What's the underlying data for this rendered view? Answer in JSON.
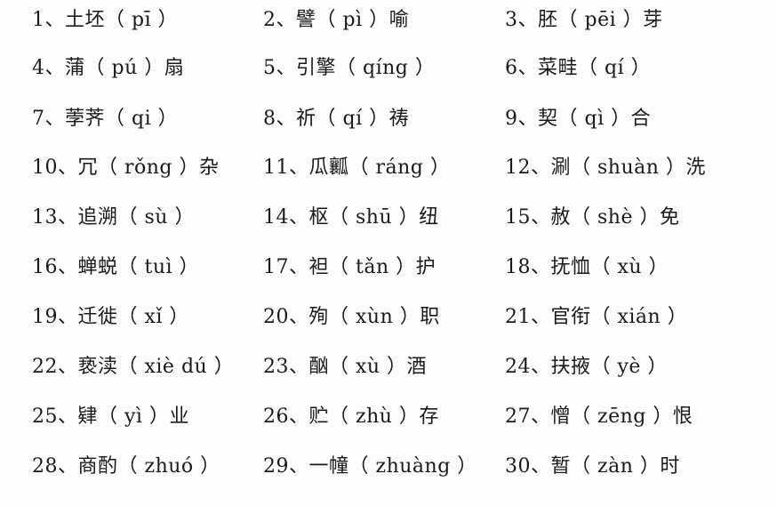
{
  "rows": [
    [
      {
        "text": "1、土坯（ pī ）"
      },
      {
        "text": "2、譬（ pì ）喻"
      },
      {
        "text": "3、胚（ pēi ）芽"
      }
    ],
    [
      {
        "text": "4、蒲（ pú ）扇"
      },
      {
        "text": "5、引擎（ qíng ）"
      },
      {
        "text": "6、菜畦（  qí  ）"
      }
    ],
    [
      {
        "text": "7、荸荠（  qi  ）"
      },
      {
        "text": "8、祈（  qí  ）祷"
      },
      {
        "text": "9、契（ qì ）合"
      }
    ],
    [
      {
        "text": "10、冗（ rǒng ）杂"
      },
      {
        "text": "11、瓜瓤（ ráng ）"
      },
      {
        "text": "12、涮（ shuàn ）洗"
      }
    ],
    [
      {
        "text": "13、追溯（  sù  ）"
      },
      {
        "text": "14、枢（  shū  ）纽"
      },
      {
        "text": "15、赦（ shè ）免"
      }
    ],
    [
      {
        "text": "16、蝉蜕（  tuì  ）"
      },
      {
        "text": "17、袒（ tǎn ）护"
      },
      {
        "text": "18、抚恤（  xù  ）"
      }
    ],
    [
      {
        "text": "19、迁徙（  xǐ  ）"
      },
      {
        "text": "20、殉（  xùn  ）职"
      },
      {
        "text": "21、官衔（  xián  ）"
      }
    ],
    [
      {
        "text": "22、亵渎（  xiè dú  ）"
      },
      {
        "text": "23、酗（  xù  ）酒"
      },
      {
        "text": "24、扶掖（  yè  ）"
      }
    ],
    [
      {
        "text": "25、肄（  yì  ）业"
      },
      {
        "text": "26、贮（  zhù  ）存"
      },
      {
        "text": "27、憎（ zēng  ）恨"
      }
    ],
    [
      {
        "text": "28、商酌（ zhuó ）"
      },
      {
        "text": "29、一幢（ zhuàng ）"
      },
      {
        "text": "30、暂（  zàn  ）时"
      }
    ]
  ]
}
